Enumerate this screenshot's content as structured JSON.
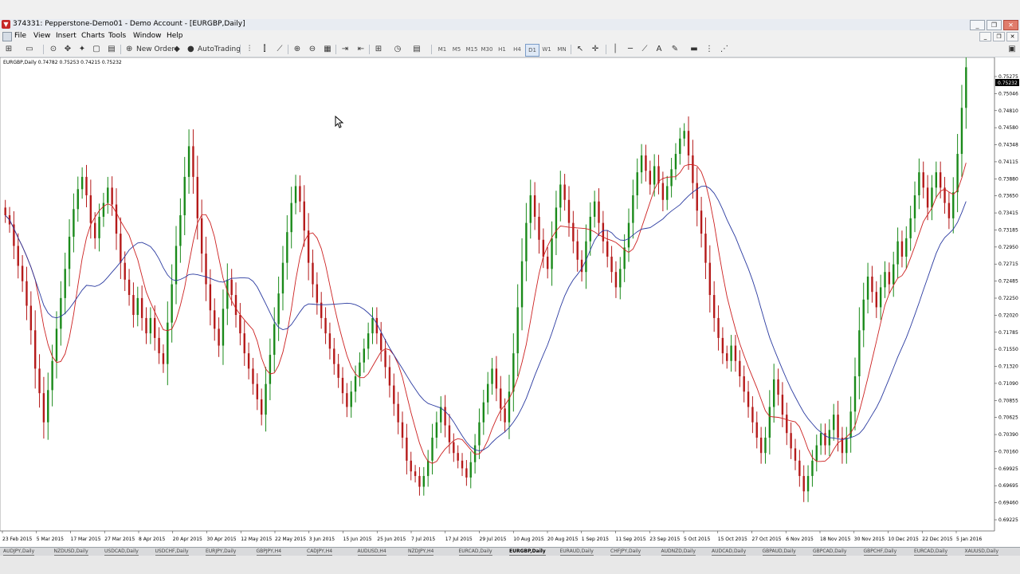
{
  "window": {
    "title": "374331: Pepperstone-Demo01 - Demo Account - [EURGBP,Daily]",
    "controls": [
      "_",
      "❐",
      "✕"
    ],
    "mdi_controls": [
      "_",
      "❐",
      "✕"
    ]
  },
  "menu": [
    "File",
    "View",
    "Insert",
    "Charts",
    "Tools",
    "Window",
    "Help"
  ],
  "toolbar": {
    "new_order": "New Order",
    "autotrading": "AutoTrading",
    "timeframes": [
      "M1",
      "M5",
      "M15",
      "M30",
      "H1",
      "H4",
      "D1",
      "W1",
      "MN"
    ],
    "active_timeframe": "D1",
    "search_placeholder": ""
  },
  "chart": {
    "symbol_line": "EURGBP,Daily  0.74782 0.75253 0.74215 0.75232",
    "current_price": "0.75232",
    "price_labels": [
      "0.75275",
      "0.75046",
      "0.74810",
      "0.74580",
      "0.74348",
      "0.74115",
      "0.73880",
      "0.73650",
      "0.73415",
      "0.73185",
      "0.72950",
      "0.72715",
      "0.72485",
      "0.72250",
      "0.72020",
      "0.71785",
      "0.71550",
      "0.71320",
      "0.71090",
      "0.70855",
      "0.70625",
      "0.70390",
      "0.70160",
      "0.69925",
      "0.69695",
      "0.69460",
      "0.69225"
    ],
    "date_labels": [
      "23 Feb 2015",
      "5 Mar 2015",
      "17 Mar 2015",
      "27 Mar 2015",
      "8 Apr 2015",
      "20 Apr 2015",
      "30 Apr 2015",
      "12 May 2015",
      "22 May 2015",
      "3 Jun 2015",
      "15 Jun 2015",
      "25 Jun 2015",
      "7 Jul 2015",
      "17 Jul 2015",
      "29 Jul 2015",
      "10 Aug 2015",
      "20 Aug 2015",
      "1 Sep 2015",
      "11 Sep 2015",
      "23 Sep 2015",
      "5 Oct 2015",
      "15 Oct 2015",
      "27 Oct 2015",
      "6 Nov 2015",
      "18 Nov 2015",
      "30 Nov 2015",
      "10 Dec 2015",
      "22 Dec 2015",
      "5 Jan 2016"
    ],
    "colors": {
      "bull": "#1a8a1a",
      "bear": "#b51a1a",
      "ma_fast": "#cc2020",
      "ma_slow": "#2a3aa0",
      "background": "#ffffff"
    }
  },
  "chart_data": {
    "type": "candlestick",
    "title": "EURGBP,Daily",
    "ylim": [
      0.69225,
      0.75275
    ],
    "closes": [
      0.733,
      0.7318,
      0.729,
      0.7264,
      0.7244,
      0.7212,
      0.718,
      0.713,
      0.7098,
      0.706,
      0.7102,
      0.714,
      0.7182,
      0.7222,
      0.726,
      0.7302,
      0.7338,
      0.7364,
      0.738,
      0.7356,
      0.732,
      0.73,
      0.7328,
      0.7346,
      0.7366,
      0.7344,
      0.7306,
      0.7268,
      0.7246,
      0.7226,
      0.72,
      0.7222,
      0.7196,
      0.7176,
      0.7196,
      0.717,
      0.715,
      0.7136,
      0.719,
      0.724,
      0.729,
      0.733,
      0.738,
      0.742,
      0.738,
      0.7326,
      0.728,
      0.724,
      0.7206,
      0.7182,
      0.716,
      0.7208,
      0.7246,
      0.7226,
      0.72,
      0.7176,
      0.715,
      0.713,
      0.711,
      0.709,
      0.707,
      0.711,
      0.7148,
      0.7188,
      0.7228,
      0.7268,
      0.7308,
      0.7346,
      0.7368,
      0.7348,
      0.731,
      0.7268,
      0.724,
      0.7216,
      0.7196,
      0.7176,
      0.7156,
      0.7136,
      0.7118,
      0.7098,
      0.708,
      0.71,
      0.712,
      0.7138,
      0.7156,
      0.7176,
      0.7196,
      0.7176,
      0.7154,
      0.7132,
      0.7108,
      0.7084,
      0.706,
      0.704,
      0.701,
      0.6996,
      0.699,
      0.6976,
      0.699,
      0.701,
      0.704,
      0.706,
      0.708,
      0.7056,
      0.7034,
      0.702,
      0.701,
      0.7,
      0.6988,
      0.7008,
      0.703,
      0.706,
      0.7086,
      0.711,
      0.713,
      0.7104,
      0.7078,
      0.706,
      0.71,
      0.715,
      0.721,
      0.727,
      0.732,
      0.7356,
      0.7328,
      0.7298,
      0.7276,
      0.726,
      0.73,
      0.734,
      0.737,
      0.735,
      0.732,
      0.7296,
      0.7272,
      0.7256,
      0.7296,
      0.7328,
      0.7348,
      0.732,
      0.7296,
      0.7276,
      0.7256,
      0.7236,
      0.726,
      0.7288,
      0.732,
      0.7356,
      0.7386,
      0.7408,
      0.7388,
      0.737,
      0.7394,
      0.7372,
      0.735,
      0.7368,
      0.739,
      0.741,
      0.743,
      0.744,
      0.7408,
      0.7372,
      0.7336,
      0.7306,
      0.7268,
      0.7226,
      0.7196,
      0.717,
      0.715,
      0.714,
      0.716,
      0.714,
      0.712,
      0.71,
      0.708,
      0.706,
      0.704,
      0.702,
      0.704,
      0.708,
      0.7116,
      0.7096,
      0.707,
      0.7046,
      0.7026,
      0.701,
      0.699,
      0.697,
      0.699,
      0.701,
      0.703,
      0.7046,
      0.703,
      0.705,
      0.707,
      0.704,
      0.702,
      0.704,
      0.7074,
      0.712,
      0.718,
      0.722,
      0.725,
      0.723,
      0.721,
      0.7236,
      0.7256,
      0.724,
      0.7266,
      0.7296,
      0.7276,
      0.73,
      0.7326,
      0.7356,
      0.7386,
      0.7366,
      0.734,
      0.7366,
      0.7386,
      0.7366,
      0.7346,
      0.7326,
      0.736,
      0.741,
      0.747,
      0.7523
    ],
    "opens": [
      0.734,
      0.733,
      0.7318,
      0.729,
      0.7264,
      0.7244,
      0.7212,
      0.718,
      0.713,
      0.7098,
      0.706,
      0.7102,
      0.714,
      0.7182,
      0.7222,
      0.726,
      0.7302,
      0.7338,
      0.7364,
      0.738,
      0.7356,
      0.732,
      0.73,
      0.7328,
      0.7346,
      0.7366,
      0.7344,
      0.7306,
      0.7268,
      0.7246,
      0.7226,
      0.72,
      0.7222,
      0.7196,
      0.7176,
      0.7196,
      0.717,
      0.715,
      0.7136,
      0.719,
      0.724,
      0.729,
      0.733,
      0.738,
      0.742,
      0.738,
      0.7326,
      0.728,
      0.724,
      0.7206,
      0.7182,
      0.716,
      0.7208,
      0.7246,
      0.7226,
      0.72,
      0.7176,
      0.715,
      0.713,
      0.711,
      0.709,
      0.707,
      0.711,
      0.7148,
      0.7188,
      0.7228,
      0.7268,
      0.7308,
      0.7346,
      0.7368,
      0.7348,
      0.731,
      0.7268,
      0.724,
      0.7216,
      0.7196,
      0.7176,
      0.7156,
      0.7136,
      0.7118,
      0.7098,
      0.708,
      0.71,
      0.712,
      0.7138,
      0.7156,
      0.7176,
      0.7196,
      0.7176,
      0.7154,
      0.7132,
      0.7108,
      0.7084,
      0.706,
      0.704,
      0.701,
      0.6996,
      0.699,
      0.6976,
      0.699,
      0.701,
      0.704,
      0.706,
      0.708,
      0.7056,
      0.7034,
      0.702,
      0.701,
      0.7,
      0.6988,
      0.7008,
      0.703,
      0.706,
      0.7086,
      0.711,
      0.713,
      0.7104,
      0.7078,
      0.706,
      0.71,
      0.715,
      0.721,
      0.727,
      0.732,
      0.7356,
      0.7328,
      0.7298,
      0.7276,
      0.726,
      0.73,
      0.734,
      0.737,
      0.735,
      0.732,
      0.7296,
      0.7272,
      0.7256,
      0.7296,
      0.7328,
      0.7348,
      0.732,
      0.7296,
      0.7276,
      0.7256,
      0.7236,
      0.726,
      0.7288,
      0.732,
      0.7356,
      0.7386,
      0.7408,
      0.7388,
      0.737,
      0.7394,
      0.7372,
      0.735,
      0.7368,
      0.739,
      0.741,
      0.743,
      0.744,
      0.7408,
      0.7372,
      0.7336,
      0.7306,
      0.7268,
      0.7226,
      0.7196,
      0.717,
      0.715,
      0.714,
      0.716,
      0.714,
      0.712,
      0.71,
      0.708,
      0.706,
      0.704,
      0.702,
      0.704,
      0.708,
      0.7116,
      0.7096,
      0.707,
      0.7046,
      0.7026,
      0.701,
      0.699,
      0.697,
      0.699,
      0.701,
      0.703,
      0.7046,
      0.703,
      0.705,
      0.707,
      0.704,
      0.702,
      0.704,
      0.7074,
      0.712,
      0.718,
      0.722,
      0.725,
      0.723,
      0.721,
      0.7236,
      0.7256,
      0.724,
      0.7266,
      0.7296,
      0.7276,
      0.73,
      0.7326,
      0.7356,
      0.7386,
      0.7366,
      0.734,
      0.7366,
      0.7386,
      0.7366,
      0.7346,
      0.7326,
      0.736,
      0.741,
      0.747
    ],
    "series": [
      {
        "values_source": "ma_fast"
      },
      {
        "values_source": "ma_slow"
      }
    ]
  },
  "tabs": [
    "AUDJPY,Daily",
    "NZDUSD,Daily",
    "USDCAD,Daily",
    "USDCHF,Daily",
    "EURJPY,Daily",
    "GBPJPY,H4",
    "CADJPY,H4",
    "AUDUSD,H4",
    "NZDJPY,H4",
    "EURCAD,Daily",
    "EURGBP,Daily",
    "EURAUD,Daily",
    "CHFJPY,Daily",
    "AUDNZD,Daily",
    "AUDCAD,Daily",
    "GBPAUD,Daily",
    "GBPCAD,Daily",
    "GBPCHF,Daily",
    "EURCAD,Daily",
    "XAUUSD,Daily"
  ],
  "active_tab": "EURGBP,Daily"
}
